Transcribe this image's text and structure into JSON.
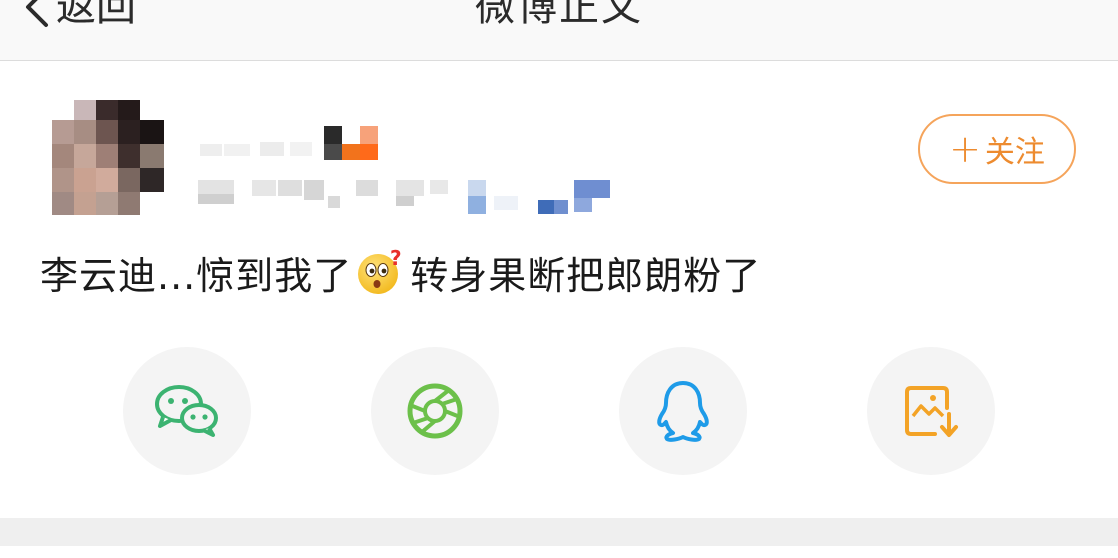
{
  "navbar": {
    "back_label": "返回",
    "title": "微博正文"
  },
  "post": {
    "follow_label": "关注",
    "text_before_emoji": "李云迪...惊到我了",
    "text_after_emoji": "转身果断把郎朗粉了",
    "emoji_icon": "surprised-question-emoji"
  },
  "share": {
    "items": [
      {
        "icon": "wechat-icon",
        "color": "#3cb371"
      },
      {
        "icon": "moments-icon",
        "color": "#6cc04a"
      },
      {
        "icon": "qq-icon",
        "color": "#1e9be8"
      },
      {
        "icon": "save-image-icon",
        "color": "#f3a326"
      }
    ]
  },
  "colors": {
    "accent_orange": "#ed8b2f",
    "navbar_bg": "#f9f9f9",
    "share_bg": "#f4f4f4"
  }
}
